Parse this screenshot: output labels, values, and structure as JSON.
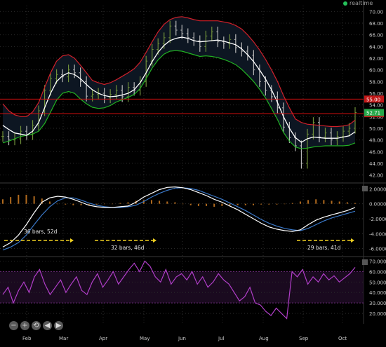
{
  "status": {
    "label": "realtime",
    "color": "#25c15a"
  },
  "toolbar": {
    "buttons": [
      {
        "name": "zoom-out-button",
        "glyph": "−"
      },
      {
        "name": "zoom-in-button",
        "glyph": "+"
      },
      {
        "name": "reset-button",
        "glyph": "⟲"
      },
      {
        "name": "pan-left-button",
        "glyph": "◀"
      },
      {
        "name": "pan-right-button",
        "glyph": "▶"
      }
    ]
  },
  "colors": {
    "background": "#000000",
    "grid": "#2a2a2a",
    "upper_band": "#d0202a",
    "lower_band": "#22b322",
    "midline": "#ffffff",
    "price_up": "#6f8f3a",
    "price_down": "#b8b8b8",
    "resistance": "#d11",
    "macd": "#ffffff",
    "signal": "#3a78c8",
    "histogram": "#b06a1e",
    "rsi": "#b13ec9",
    "rsi_band": "#1a0a1f",
    "cycle_arrow": "#f0d020"
  },
  "chart_data": [
    {
      "type": "line",
      "title": "",
      "x_labels": [
        "Feb",
        "Mar",
        "Apr",
        "May",
        "Jun",
        "Jul",
        "Aug",
        "Sep",
        "Oct"
      ],
      "ylim": [
        41,
        71
      ],
      "yticks": [
        "42.00",
        "44.00",
        "46.00",
        "48.00",
        "50.00",
        "52.00",
        "54.00",
        "56.00",
        "58.00",
        "60.00",
        "62.00",
        "64.00",
        "66.00",
        "68.00",
        "70.00"
      ],
      "horizontal_lines": [
        {
          "value": 55.0,
          "label": "55.00",
          "style": "red-box"
        },
        {
          "value": 52.5,
          "label": "52.50",
          "style": "red-box"
        }
      ],
      "last_price": {
        "value": 52.71,
        "label": "52.71",
        "color": "#25a84a"
      },
      "series": [
        {
          "role": "midline",
          "values": [
            50.5,
            49.8,
            49.2,
            49.0,
            48.8,
            49.5,
            51.0,
            53.5,
            56.0,
            58.0,
            59.0,
            59.5,
            59.2,
            58.5,
            57.5,
            56.6,
            56.0,
            55.6,
            55.4,
            55.5,
            55.7,
            56.0,
            56.6,
            57.8,
            59.5,
            61.4,
            63.0,
            64.2,
            65.0,
            65.4,
            65.6,
            65.4,
            65.0,
            64.8,
            64.9,
            65.0,
            65.1,
            64.9,
            64.6,
            64.3,
            63.6,
            62.6,
            61.4,
            60.0,
            58.4,
            56.6,
            54.4,
            52.0,
            50.0,
            48.4,
            47.6,
            48.2,
            48.5,
            48.4,
            48.3,
            48.3,
            48.3,
            48.5,
            48.7,
            49.4
          ]
        },
        {
          "role": "upper-band",
          "values": [
            54.2,
            53.0,
            52.3,
            52.0,
            52.0,
            52.8,
            54.4,
            57.0,
            59.5,
            61.5,
            62.4,
            62.6,
            62.0,
            60.8,
            59.5,
            58.2,
            57.8,
            57.5,
            57.8,
            58.3,
            58.9,
            59.5,
            60.2,
            61.3,
            63.0,
            64.8,
            66.5,
            67.8,
            68.6,
            69.0,
            69.1,
            68.9,
            68.6,
            68.4,
            68.4,
            68.4,
            68.4,
            68.2,
            68.0,
            67.6,
            67.0,
            66.0,
            64.8,
            63.4,
            61.8,
            60.0,
            58.0,
            55.6,
            53.5,
            51.6,
            51.0,
            50.7,
            50.6,
            50.5,
            50.4,
            50.3,
            50.3,
            50.4,
            50.6,
            51.4
          ]
        },
        {
          "role": "lower-band",
          "values": [
            47.5,
            47.8,
            48.2,
            48.6,
            48.8,
            49.0,
            49.5,
            50.8,
            52.8,
            54.8,
            56.0,
            56.3,
            56.0,
            55.0,
            54.2,
            53.6,
            53.4,
            53.5,
            53.9,
            54.5,
            54.9,
            55.3,
            55.8,
            56.8,
            58.5,
            60.3,
            61.7,
            62.7,
            63.2,
            63.3,
            63.2,
            62.9,
            62.6,
            62.3,
            62.4,
            62.3,
            62.1,
            61.8,
            61.4,
            60.9,
            60.1,
            59.1,
            58.0,
            56.7,
            55.2,
            53.4,
            51.5,
            49.3,
            47.8,
            46.8,
            46.5,
            46.6,
            46.8,
            46.9,
            47.0,
            47.0,
            47.0,
            47.0,
            47.1,
            47.5
          ]
        },
        {
          "role": "price",
          "values": [
            48.6,
            48.0,
            48.2,
            49.5,
            48.9,
            50.5,
            53.0,
            56.5,
            58.5,
            59.2,
            58.8,
            60.0,
            59.5,
            58.0,
            55.5,
            55.8,
            56.0,
            55.2,
            55.8,
            56.5,
            55.4,
            57.0,
            56.5,
            58.0,
            61.5,
            63.5,
            64.5,
            65.5,
            67.5,
            66.8,
            66.2,
            65.5,
            65.0,
            64.0,
            65.8,
            66.5,
            64.8,
            64.5,
            65.2,
            63.8,
            63.2,
            62.5,
            60.0,
            58.0,
            56.5,
            55.4,
            53.5,
            50.2,
            48.4,
            47.0,
            44.0,
            49.0,
            51.0,
            48.5,
            49.2,
            48.0,
            48.6,
            49.5,
            50.0,
            52.7
          ]
        }
      ]
    },
    {
      "type": "line",
      "title": "",
      "ylim": [
        -6.7,
        2.6
      ],
      "yticks": [
        "2.0000",
        "0.0000",
        "-2.0000",
        "-4.0000",
        "-6.0000"
      ],
      "annotations": [
        {
          "label": "36 bars, 52d",
          "from_index": 0,
          "to_index": 16
        },
        {
          "label": "32 bars, 46d",
          "from_index": 20,
          "to_index": 33
        },
        {
          "label": "29 bars, 41d",
          "from_index": 69,
          "to_index": 79
        }
      ],
      "series": [
        {
          "role": "macd",
          "values": [
            -5.8,
            -5.2,
            -4.2,
            -2.8,
            -1.2,
            0.2,
            0.8,
            1.0,
            0.9,
            0.6,
            0.2,
            -0.2,
            -0.4,
            -0.5,
            -0.5,
            -0.4,
            -0.3,
            0.2,
            0.9,
            1.4,
            1.9,
            2.2,
            2.25,
            2.15,
            1.9,
            1.5,
            1.1,
            0.6,
            0.2,
            -0.3,
            -0.8,
            -1.4,
            -2.0,
            -2.6,
            -3.1,
            -3.4,
            -3.6,
            -3.7,
            -3.5,
            -2.8,
            -2.2,
            -1.8,
            -1.5,
            -1.2,
            -0.9,
            -0.5
          ]
        },
        {
          "role": "signal",
          "values": [
            -6.2,
            -5.8,
            -5.2,
            -4.2,
            -2.8,
            -1.5,
            -0.4,
            0.4,
            0.8,
            0.8,
            0.5,
            0.1,
            -0.2,
            -0.4,
            -0.5,
            -0.5,
            -0.4,
            -0.2,
            0.3,
            0.9,
            1.4,
            1.8,
            2.1,
            2.15,
            2.05,
            1.8,
            1.4,
            1.0,
            0.6,
            0.1,
            -0.4,
            -0.9,
            -1.5,
            -2.1,
            -2.6,
            -3.0,
            -3.3,
            -3.5,
            -3.6,
            -3.3,
            -2.8,
            -2.3,
            -1.9,
            -1.6,
            -1.3,
            -1.0
          ]
        },
        {
          "role": "histogram",
          "values": [
            0.6,
            0.9,
            1.2,
            1.2,
            1.0,
            0.7,
            0.3,
            0.0,
            -0.1,
            -0.2,
            -0.2,
            -0.2,
            -0.1,
            0.0,
            0.0,
            0.1,
            0.2,
            0.4,
            0.5,
            0.5,
            0.4,
            0.3,
            0.2,
            0.0,
            -0.2,
            -0.3,
            -0.3,
            -0.4,
            -0.3,
            -0.2,
            -0.2,
            -0.2,
            -0.2,
            -0.1,
            -0.1,
            -0.1,
            0.0,
            0.1,
            0.3,
            0.5,
            0.6,
            0.5,
            0.4,
            0.3,
            0.2,
            0.1
          ]
        }
      ]
    },
    {
      "type": "line",
      "title": "",
      "ylim": [
        10,
        73
      ],
      "yticks": [
        "70.0000",
        "60.0000",
        "50.0000",
        "40.0000",
        "30.0000",
        "20.0000"
      ],
      "reference_lines": [
        60,
        30
      ],
      "series": [
        {
          "role": "rsi",
          "values": [
            38,
            45,
            30,
            42,
            50,
            40,
            55,
            62,
            48,
            38,
            45,
            52,
            40,
            48,
            55,
            42,
            38,
            50,
            58,
            45,
            52,
            60,
            48,
            55,
            62,
            68,
            60,
            70,
            65,
            55,
            50,
            62,
            48,
            55,
            58,
            52,
            60,
            48,
            55,
            45,
            50,
            58,
            52,
            48,
            40,
            32,
            36,
            45,
            30,
            28,
            22,
            18,
            25,
            20,
            15,
            60,
            55,
            62,
            48,
            55,
            50,
            58,
            52,
            56,
            50,
            54,
            58,
            64
          ]
        }
      ]
    }
  ]
}
